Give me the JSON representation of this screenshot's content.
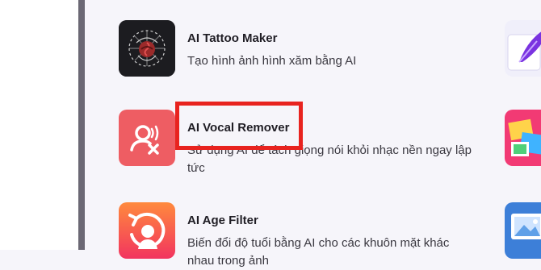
{
  "tools": [
    {
      "title": "AI Tattoo Maker",
      "description": "Tạo hình ảnh hình xăm bằng AI",
      "icon": "tattoo-rose-icon"
    },
    {
      "title": "AI Vocal Remover",
      "description": "Sử dụng AI để tách giọng nói khỏi nhạc nền ngay lập tức",
      "icon": "vocal-remove-icon"
    },
    {
      "title": "AI Age Filter",
      "description": "Biến đổi độ tuổi bằng AI cho các khuôn mặt khác nhau trong ảnh",
      "icon": "age-filter-icon"
    }
  ],
  "right_column_icons": [
    "feather-pen-icon",
    "photo-collage-icon",
    "image-gallery-icon"
  ],
  "colors": {
    "highlight": "#e8231f",
    "vocal_bg": "#ee5d63",
    "age_bg_top": "#ff8a3d",
    "age_bg_bottom": "#f2345f"
  }
}
